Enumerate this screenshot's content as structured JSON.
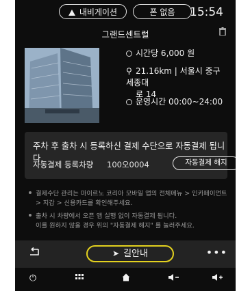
{
  "topbar": {
    "nav_label": "내비게이션",
    "phone_label": "폰 없음",
    "time": "15:54"
  },
  "detail": {
    "title": "그랜드센트럴",
    "price": "시간당 6,000 원",
    "address_line1": "21.16km | 서울시 중구 세종대",
    "address_line2": "로 14",
    "hours": "운영시간 00:00~24:00"
  },
  "payment_card": {
    "message": "주차 후 출차 시 등록하신 결제 수단으로 자동결제 됩니다.",
    "plate_label": "자동결제 등록차량",
    "plate_number": "100오0004",
    "cancel_button": "자동결제 해지"
  },
  "notes": [
    "결제수단 관리는 마이르노 코리아 모바일 앱의 전체메뉴 > 인카페이먼트",
    "> 지갑 > 신용카드를 확인해주세요.",
    "출차 시 차량에서 오픈 앱 실행 없이 자동결제 됩니다.",
    "이를 원하지 않을 경우 위의 \"자동결제 해지\" 를 눌러주세요."
  ],
  "action_bar": {
    "back_icon": "back-arrow-icon",
    "go_label": "길안내",
    "more": "•••"
  },
  "system_bar": {
    "icons": [
      "power-icon",
      "apps-grid-icon",
      "home-icon",
      "volume-down-icon",
      "volume-up-icon"
    ]
  },
  "colors": {
    "accent": "#e4d21f",
    "background": "#0d0d0d",
    "card": "#262626"
  }
}
